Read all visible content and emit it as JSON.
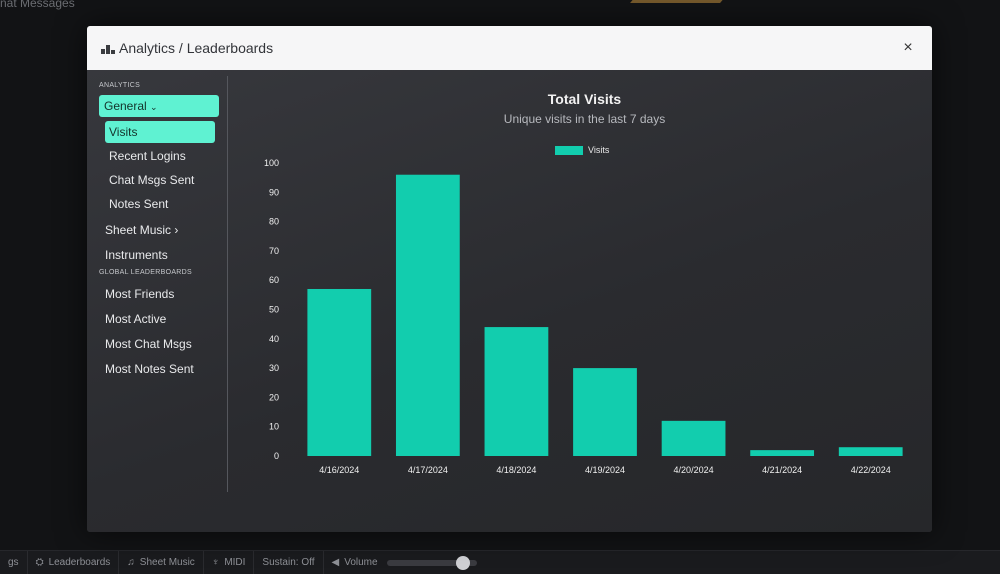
{
  "background": {
    "header_fragment": "nat Messages",
    "bottom_bar": [
      {
        "icon": "cloud-icon",
        "label": "gs"
      },
      {
        "icon": "leaderboard-icon",
        "label": "Leaderboards"
      },
      {
        "icon": "music-note-icon",
        "label": "Sheet Music"
      },
      {
        "icon": "midi-icon",
        "label": "MIDI"
      },
      {
        "icon": "",
        "label": "Sustain: Off"
      },
      {
        "icon": "speaker-icon",
        "label": "Volume"
      }
    ],
    "volume_level": 0.85
  },
  "modal": {
    "title": "Analytics / Leaderboards",
    "close_glyph": "×"
  },
  "sidebar": {
    "analytics_label": "ANALYTICS",
    "general_label": "General",
    "general_items": [
      "Visits",
      "Recent Logins",
      "Chat Msgs Sent",
      "Notes Sent"
    ],
    "active_item": "Visits",
    "sheet_music_label": "Sheet Music",
    "instruments_label": "Instruments",
    "global_label": "GLOBAL LEADERBOARDS",
    "global_items": [
      "Most Friends",
      "Most Active",
      "Most Chat Msgs",
      "Most Notes Sent"
    ]
  },
  "chart_data": {
    "type": "bar",
    "title": "Total Visits",
    "subtitle": "Unique visits in the last 7 days",
    "categories": [
      "4/16/2024",
      "4/17/2024",
      "4/18/2024",
      "4/19/2024",
      "4/20/2024",
      "4/21/2024",
      "4/22/2024"
    ],
    "series": [
      {
        "name": "Visits",
        "values": [
          57,
          96,
          44,
          30,
          12,
          2,
          3
        ]
      }
    ],
    "ylim": [
      0,
      100
    ],
    "yticks": [
      0,
      10,
      20,
      30,
      40,
      50,
      60,
      70,
      80,
      90,
      100
    ],
    "legend": "top-center",
    "grid": false,
    "bar_color": "#12cdae"
  },
  "colors": {
    "accent": "#5ff2d2",
    "bar": "#12cdae"
  }
}
